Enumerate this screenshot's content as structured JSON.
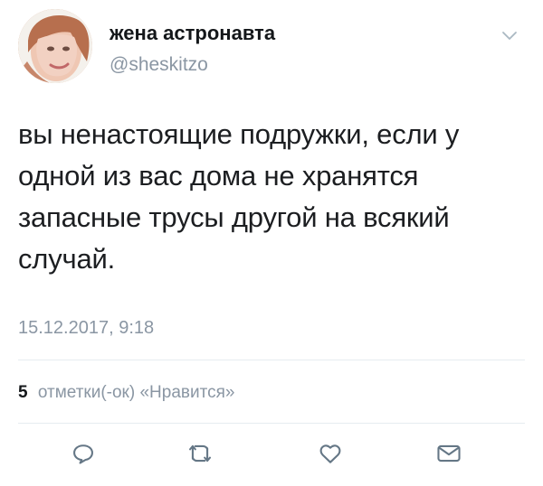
{
  "author": {
    "display_name": "жена астронавта",
    "handle": "@sheskitzo"
  },
  "tweet": {
    "text_lines": [
      "вы ненастоящие подружки, если у",
      "одной из вас дома не хранятся",
      "запасные трусы другой на всякий",
      "случай."
    ],
    "timestamp": "15.12.2017, 9:18"
  },
  "stats": {
    "likes_count": "5",
    "likes_label": "отметки(-ок) «Нравится»"
  },
  "icons": {
    "menu": "chevron-down-icon",
    "reply": "reply-icon",
    "retweet": "retweet-icon",
    "like": "heart-icon",
    "message": "envelope-icon"
  },
  "colors": {
    "text": "#14171a",
    "secondary": "#8a96a3",
    "divider": "#e6ecf0"
  }
}
